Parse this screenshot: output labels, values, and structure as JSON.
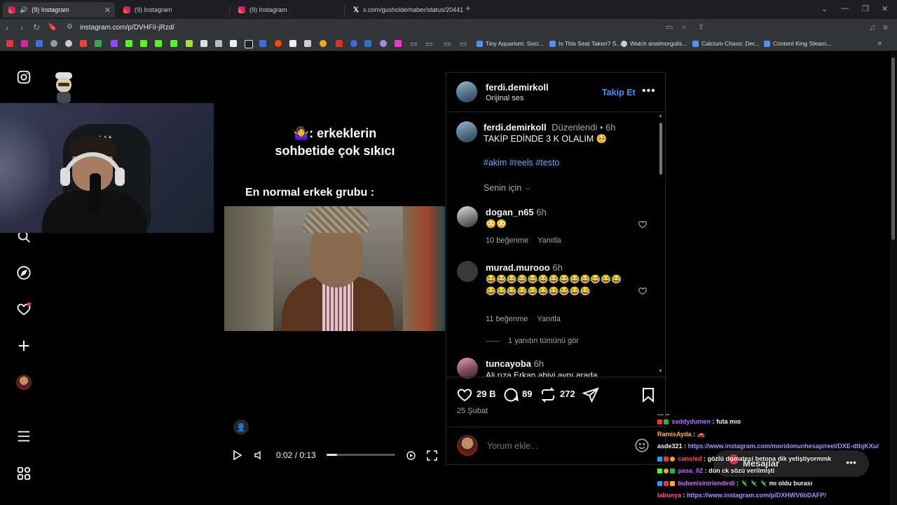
{
  "browser": {
    "tabs": [
      {
        "title": "(9) Instagram",
        "active": true
      },
      {
        "title": "(9) Instagram",
        "active": false
      },
      {
        "title": "(9) Instagram",
        "active": false
      },
      {
        "title": "x.com/gusholderhaber/status/20441",
        "active": false
      }
    ],
    "new_tab": "+",
    "url": "instagram.com/p/DVHFiI-jRzd/",
    "bookmarks": [
      {
        "label": "Tiny Aquarium: Soci..."
      },
      {
        "label": "Is This Seat Taken? S..."
      },
      {
        "label": "Watch analmorgulis..."
      },
      {
        "label": "Calcium Chaos: Der..."
      },
      {
        "label": "Content King Steam..."
      }
    ],
    "more_bookmarks": "»"
  },
  "video": {
    "caption_line1": "🤷‍♀️: erkeklerin",
    "caption_line2": "sohbetide çok sıkıcı",
    "caption_sub": "En normal erkek grubu :",
    "time": "0:02 / 0:13",
    "progress": 0.15
  },
  "post": {
    "author": "ferdi.demirkoll",
    "audio": "Orijinal ses",
    "follow_label": "Takip Et",
    "caption": {
      "author": "ferdi.demirkoll",
      "edited": "Düzenlendi",
      "time": "6h",
      "text": "TAKİP EDİNDE 3 K OLALIM 🥺",
      "hashtags": "#akim #reels #testo"
    },
    "sort_label": "Senin için",
    "comments": [
      {
        "user": "dogan_n65",
        "time": "6h",
        "text": "😳😳",
        "likes": "10 beğenme",
        "reply": "Yanıtla"
      },
      {
        "user": "murad.murooo",
        "time": "6h",
        "text": "😂😂😂😂😂😂😂😂😂😂😂😂😂😂😂😂😂😂😂😂😂😂😂",
        "likes": "11 beğenme",
        "reply": "Yanıtla",
        "view_replies": "1 yanıtın tümünü gör"
      },
      {
        "user": "tuncayoba",
        "time": "6h",
        "text": "Ali rıza Erkan abiyi aynı arada"
      }
    ],
    "like_count": "29 B",
    "comment_count": "89",
    "repost_count": "272",
    "date": "25 Şubat",
    "comment_placeholder": "Yorum ekle..."
  },
  "messages": {
    "label": "Mesajlar",
    "badge": "9+"
  },
  "chat": [
    {
      "user": "saddydumen",
      "sep": ":",
      "text": "futa mıo",
      "color": "#b86bff"
    },
    {
      "user": "RamisAyda",
      "sep": ":",
      "text": "🚗",
      "color": "#ffb347"
    },
    {
      "user": "asde321",
      "sep": ":",
      "text": "https://www.instagram.com/moridonunhesap/reel/DXE-dtbjKXu/",
      "color": "#f5f5f5",
      "link": true
    },
    {
      "user": "canoled",
      "sep": ":",
      "text": "gözlü domatesi betona dik yetiştiyormmk",
      "color": "#ff4d4d"
    },
    {
      "user": "pasa_02",
      "sep": ":",
      "text": "dün ck sözü verilmişti",
      "color": "#b86bff"
    },
    {
      "user": "bubenisinirlendirdi",
      "sep": ":",
      "text": "🦎 🦎 🦎 mı oldu burası",
      "color": "#d66bff"
    },
    {
      "user": "labunya",
      "sep": ":",
      "text": "https://www.instagram.com/p/DXHWV6bDAFP/",
      "color": "#ff4da6",
      "link": true
    }
  ],
  "colors": {
    "accent_link": "#6ea8ff",
    "background": "#000000",
    "notification": "#ff3040"
  }
}
